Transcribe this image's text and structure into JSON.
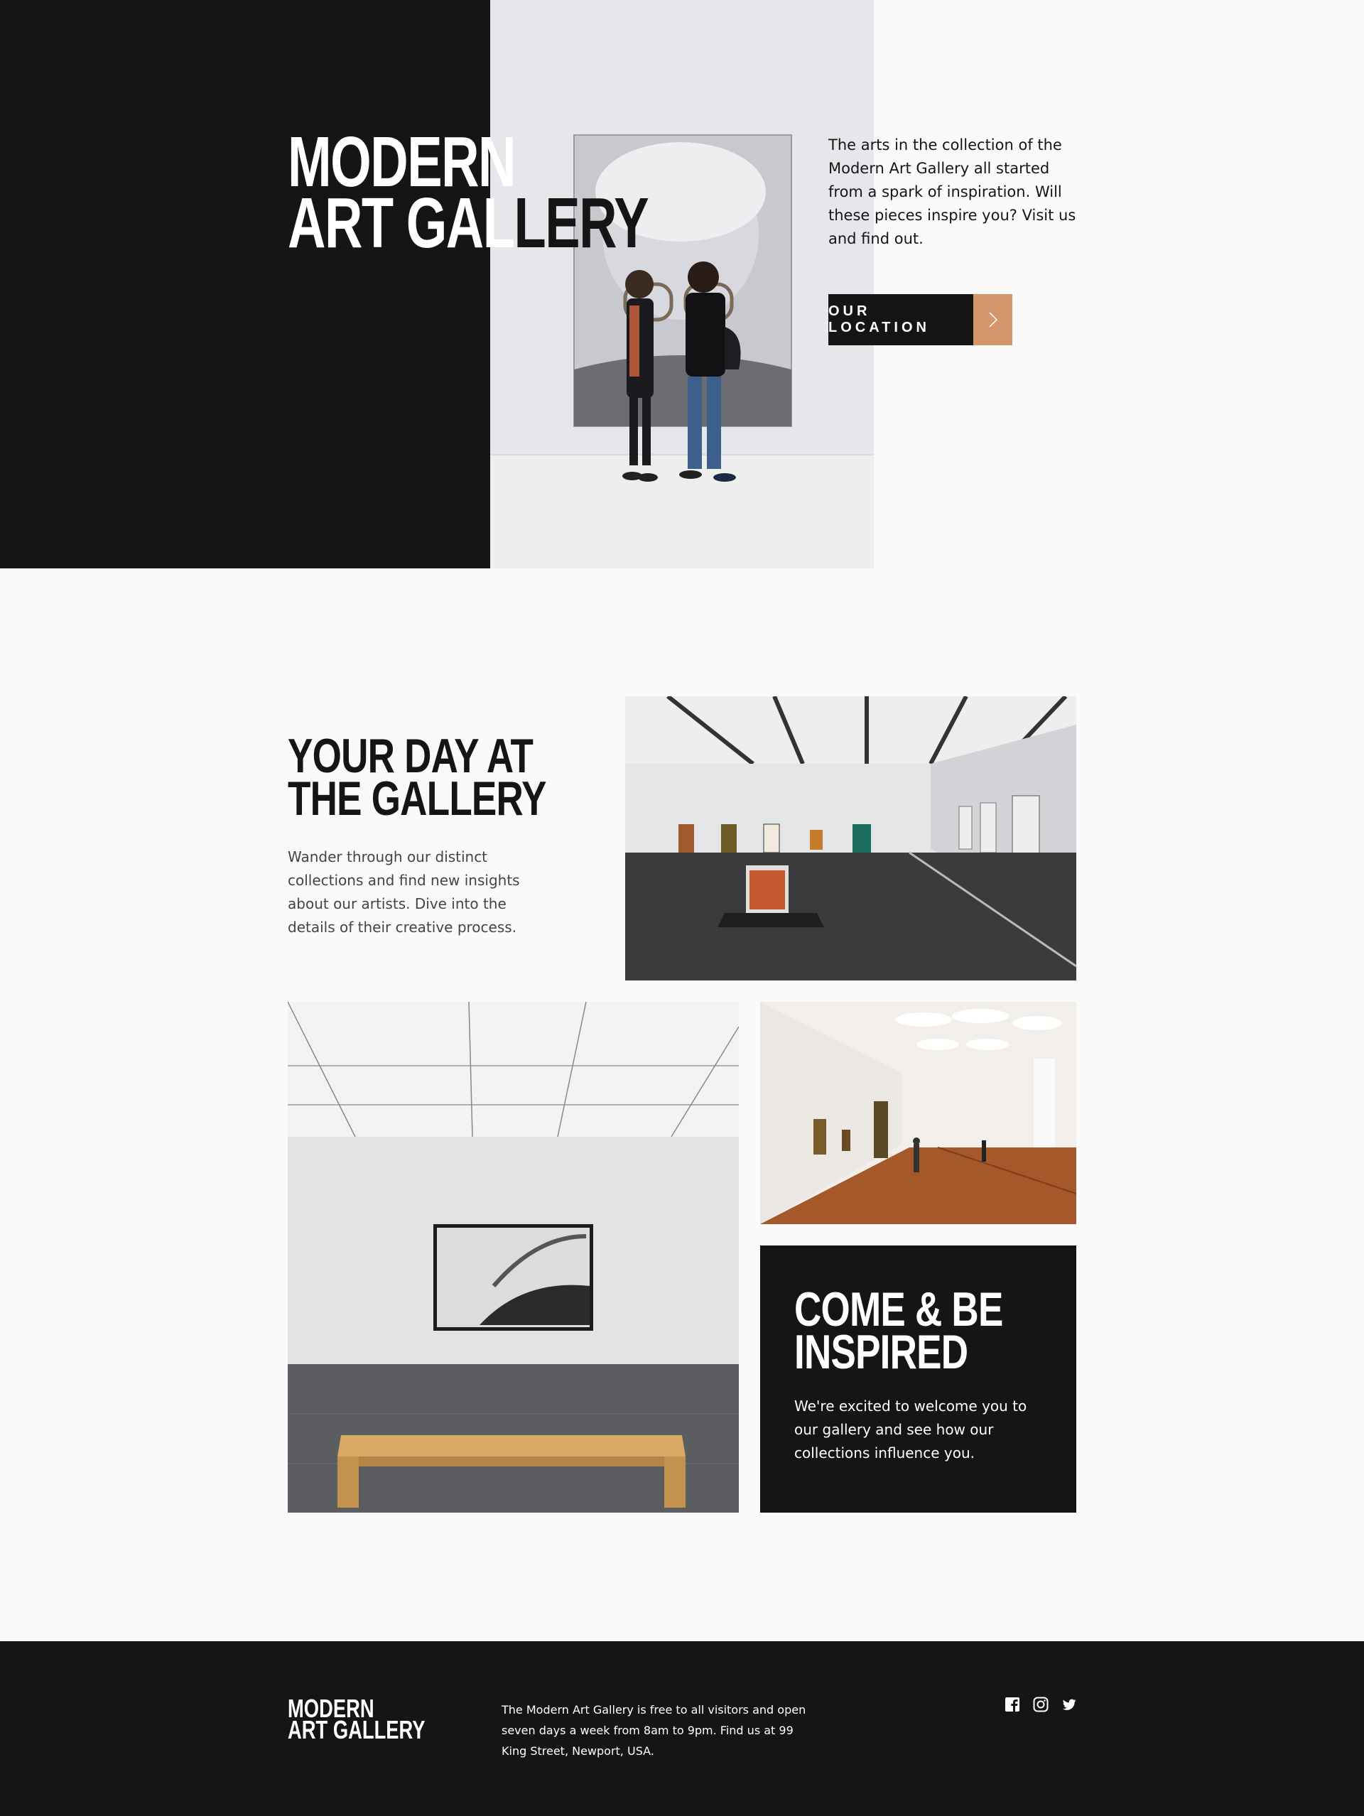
{
  "hero": {
    "title_line1": "MODERN",
    "title_line2_white": "ART GAL",
    "title_line2_dark": "LERY",
    "description": "The arts in the collection of the Modern Art Gallery all started from a spark of inspiration. Will these pieces inspire you? Visit us and find out.",
    "button_label": "OUR LOCATION",
    "button_icon": "chevron-right-icon"
  },
  "gallery": {
    "title_line1": "YOUR DAY AT",
    "title_line2": "THE GALLERY",
    "description": "Wander through our distinct collections and find new insights about our artists. Dive into the details of their creative process."
  },
  "inspired": {
    "title_line1": "COME & BE",
    "title_line2": "INSPIRED",
    "description": "We're excited to welcome you to our gallery and see how our collections influence you."
  },
  "footer": {
    "logo_line1": "MODERN",
    "logo_line2": "ART GALLERY",
    "description": "The Modern Art Gallery is free to all visitors and open seven days a week from 8am to 9pm. Find us at 99 King Street, Newport, USA.",
    "social": [
      "facebook-icon",
      "instagram-icon",
      "twitter-icon"
    ]
  },
  "colors": {
    "dark": "#151515",
    "light": "#fafafa",
    "accent": "#d5966c"
  }
}
